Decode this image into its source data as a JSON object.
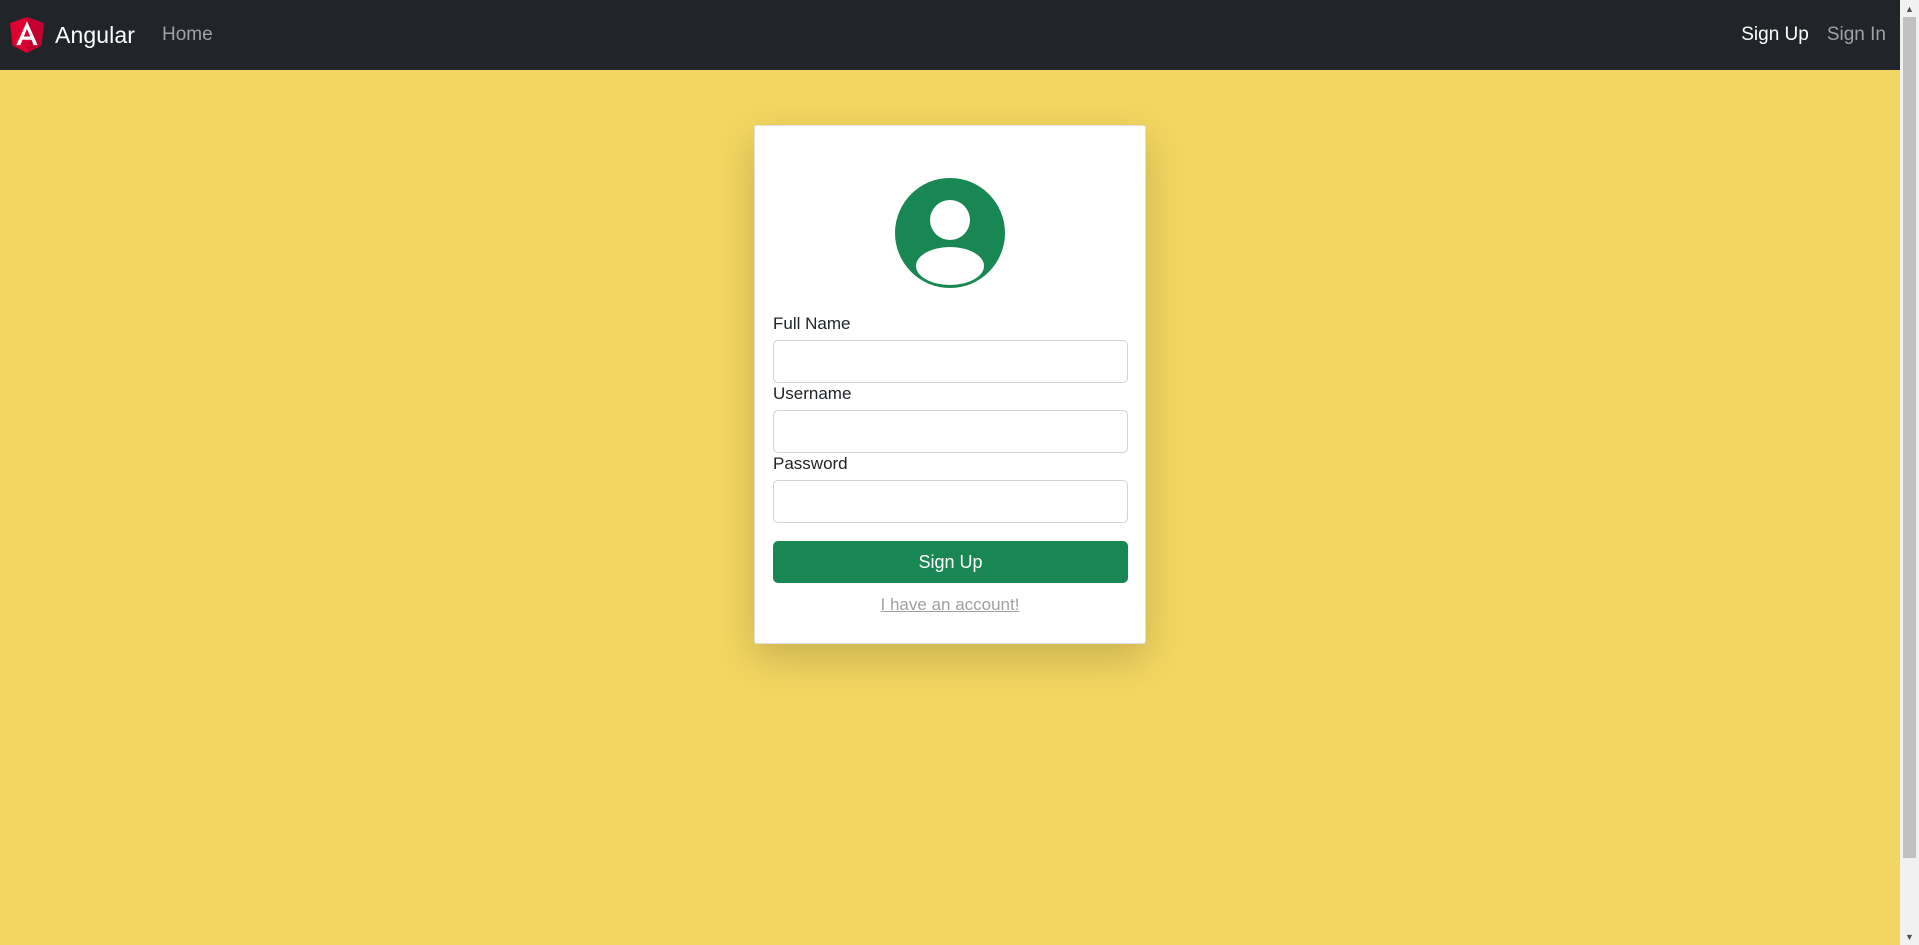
{
  "navbar": {
    "brand_text": "Angular",
    "brand_icon": "angular-logo-icon",
    "home_label": "Home",
    "signup_label": "Sign Up",
    "signin_label": "Sign In"
  },
  "form": {
    "avatar_icon": "user-avatar-icon",
    "fields": [
      {
        "label": "Full Name",
        "value": ""
      },
      {
        "label": "Username",
        "value": ""
      },
      {
        "label": "Password",
        "value": ""
      }
    ],
    "submit_label": "Sign Up",
    "account_link": "I have an account!"
  },
  "colors": {
    "page_background": "#f3d661",
    "navbar_background": "#212529",
    "accent_green": "#198754",
    "angular_red": "#dd0031"
  }
}
